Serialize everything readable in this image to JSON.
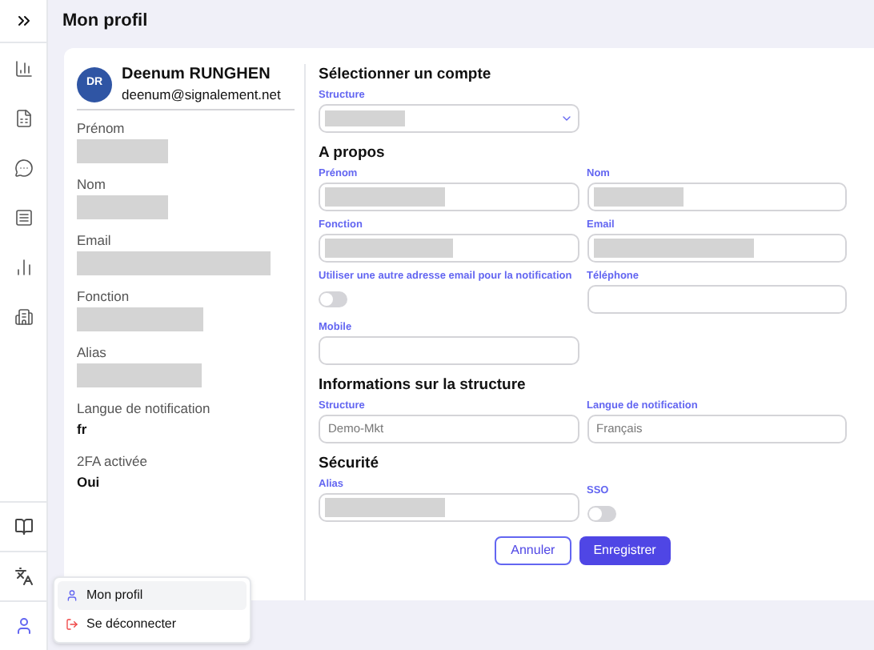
{
  "page_title": "Mon profil",
  "profile": {
    "initials": "DR",
    "name": "Deenum RUNGHEN",
    "email": "deenum@signalement.net",
    "fields": [
      {
        "label": "Prénom",
        "redacted": true
      },
      {
        "label": "Nom",
        "redacted": true
      },
      {
        "label": "Email",
        "redacted": true
      },
      {
        "label": "Fonction",
        "redacted": true
      },
      {
        "label": "Alias",
        "redacted": true
      },
      {
        "label": "Langue de notification",
        "value": "fr"
      },
      {
        "label": "2FA activée",
        "value": "Oui"
      }
    ]
  },
  "sections": [
    {
      "title": "Sélectionner un compte",
      "fields": [
        {
          "label": "Structure",
          "kind": "select",
          "redacted": true
        }
      ]
    },
    {
      "title": "A propos",
      "fields": [
        {
          "label": "Prénom",
          "kind": "input",
          "redacted": true
        },
        {
          "label": "Nom",
          "kind": "input",
          "redacted": true
        },
        {
          "label": "Fonction",
          "kind": "input",
          "redacted": true
        },
        {
          "label": "Email",
          "kind": "input",
          "redacted": true
        },
        {
          "label": "Utiliser une autre adresse email pour la notification",
          "kind": "toggle",
          "on": false
        },
        {
          "label": "Téléphone",
          "kind": "input"
        },
        {
          "label": "Mobile",
          "kind": "input"
        }
      ]
    },
    {
      "title": "Informations sur la structure",
      "fields": [
        {
          "label": "Structure",
          "kind": "input",
          "value": "Demo-Mkt",
          "disabled": true
        },
        {
          "label": "Langue de notification",
          "kind": "input",
          "value": "Français",
          "disabled": true
        }
      ]
    },
    {
      "title": "Sécurité",
      "fields": [
        {
          "label": "Alias",
          "kind": "input",
          "redacted": true
        },
        {
          "label": "SSO",
          "kind": "toggle",
          "on": false
        }
      ]
    }
  ],
  "buttons": [
    {
      "label": "Annuler",
      "kind": "secondary"
    },
    {
      "label": "Enregistrer",
      "kind": "primary"
    }
  ],
  "user_menu": {
    "items": [
      {
        "label": "Mon profil",
        "kind": "profile",
        "selected": true
      },
      {
        "label": "Se déconnecter",
        "kind": "logout",
        "selected": false
      }
    ]
  }
}
